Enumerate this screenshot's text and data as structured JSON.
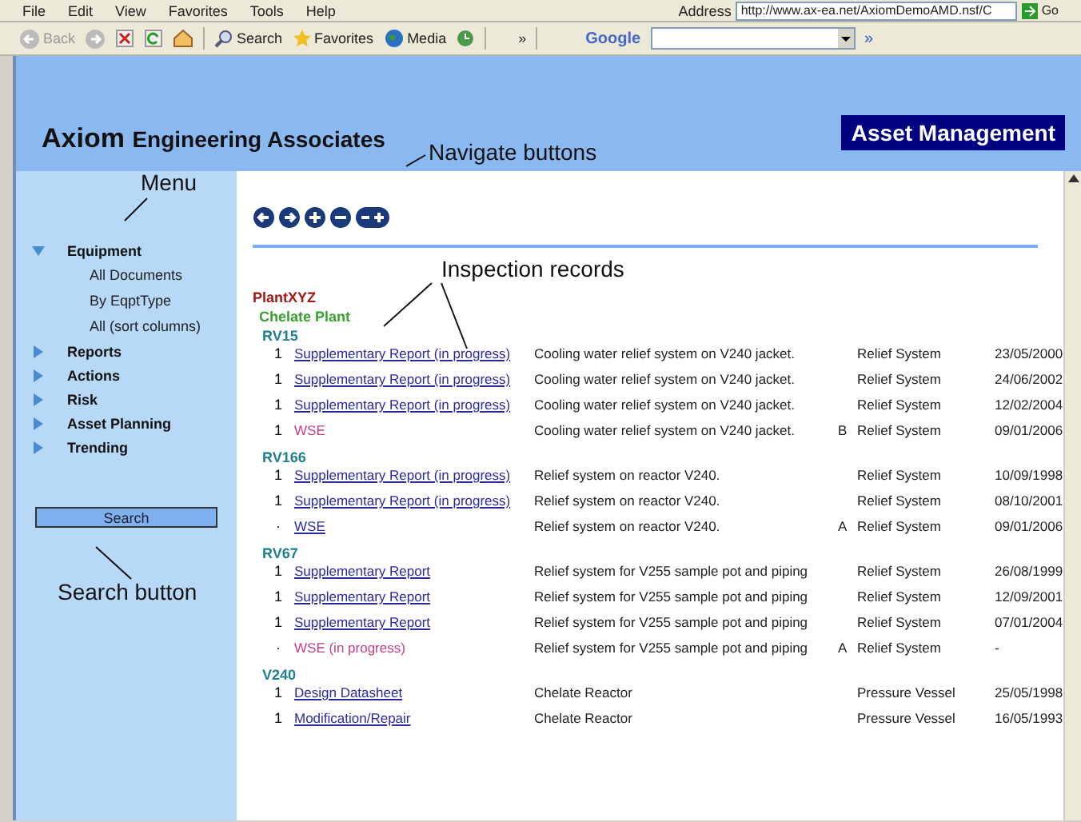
{
  "menu_bar": [
    "File",
    "Edit",
    "View",
    "Favorites",
    "Tools",
    "Help"
  ],
  "address": {
    "label": "Address",
    "url": "http://www.ax-ea.net/AxiomDemoAMD.nsf/C",
    "go": "Go"
  },
  "toolbar": {
    "back": "Back",
    "search": "Search",
    "favorites": "Favorites",
    "media": "Media",
    "more": "»",
    "google": "Google",
    "google_more": "»"
  },
  "header": {
    "company_strong": "Axiom",
    "company_rest": "Engineering Associates",
    "badge": "Asset Management"
  },
  "menu": [
    {
      "label": "Equipment",
      "expanded": true,
      "children": [
        "All Documents",
        "By EqptType",
        "All (sort columns)"
      ]
    },
    {
      "label": "Reports",
      "expanded": false
    },
    {
      "label": "Actions",
      "expanded": false
    },
    {
      "label": "Risk",
      "expanded": false
    },
    {
      "label": "Asset Planning",
      "expanded": false
    },
    {
      "label": "Trending",
      "expanded": false
    }
  ],
  "search_button": "Search",
  "annotations": [
    "Menu",
    "Navigate buttons",
    "Inspection records",
    "Search button"
  ],
  "plant": "PlantXYZ",
  "area": "Chelate Plant",
  "groups": [
    {
      "tag": "RV15",
      "rows": [
        {
          "count": "1",
          "document": "Supplementary Report (in progress)",
          "kind": "link",
          "description": "Cooling water relief system on V240 jacket.",
          "equipment_type": "Relief System",
          "date": "23/05/2000"
        },
        {
          "count": "1",
          "document": "Supplementary Report (in progress)",
          "kind": "link",
          "description": "Cooling water relief system on V240 jacket.",
          "equipment_type": "Relief System",
          "date": "24/06/2002"
        },
        {
          "count": "1",
          "document": "Supplementary Report (in progress)",
          "kind": "link",
          "description": "Cooling water relief system on V240 jacket.",
          "equipment_type": "Relief System",
          "date": "12/02/2004"
        },
        {
          "count": "1",
          "document": "WSE",
          "kind": "pending",
          "description": "Cooling water relief system on V240 jacket.",
          "flag": "B",
          "equipment_type": "Relief System",
          "date": "09/01/2006"
        }
      ]
    },
    {
      "tag": "RV166",
      "rows": [
        {
          "count": "1",
          "document": "Supplementary Report (in progress)",
          "kind": "link",
          "description": "Relief system on reactor V240.",
          "equipment_type": "Relief System",
          "date": "10/09/1998"
        },
        {
          "count": "1",
          "document": "Supplementary Report (in progress)",
          "kind": "link",
          "description": "Relief system on reactor V240.",
          "equipment_type": "Relief System",
          "date": "08/10/2001"
        },
        {
          "count": "·",
          "document": "WSE",
          "kind": "link",
          "description": "Relief system on reactor V240.",
          "flag": "A",
          "equipment_type": "Relief System",
          "date": "09/01/2006"
        }
      ]
    },
    {
      "tag": "RV67",
      "rows": [
        {
          "count": "1",
          "document": "Supplementary Report",
          "kind": "link",
          "description": "Relief system for V255 sample pot and piping",
          "equipment_type": "Relief System",
          "date": "26/08/1999"
        },
        {
          "count": "1",
          "document": "Supplementary Report",
          "kind": "link",
          "description": "Relief system for V255 sample pot and piping",
          "equipment_type": "Relief System",
          "date": "12/09/2001"
        },
        {
          "count": "1",
          "document": "Supplementary Report",
          "kind": "link",
          "description": "Relief system for V255 sample pot and piping",
          "equipment_type": "Relief System",
          "date": "07/01/2004"
        },
        {
          "count": "·",
          "document": "WSE (in progress)",
          "kind": "pending",
          "description": "Relief system for V255 sample pot and piping",
          "flag": "A",
          "equipment_type": "Relief System",
          "date": "-"
        }
      ]
    },
    {
      "tag": "V240",
      "rows": [
        {
          "count": "1",
          "document": "Design Datasheet",
          "kind": "link",
          "description": "Chelate Reactor",
          "equipment_type": "Pressure Vessel",
          "date": "25/05/1998"
        },
        {
          "count": "1",
          "document": "Modification/Repair",
          "kind": "link",
          "description": "Chelate Reactor",
          "equipment_type": "Pressure Vessel",
          "date": "16/05/1993"
        }
      ]
    }
  ]
}
